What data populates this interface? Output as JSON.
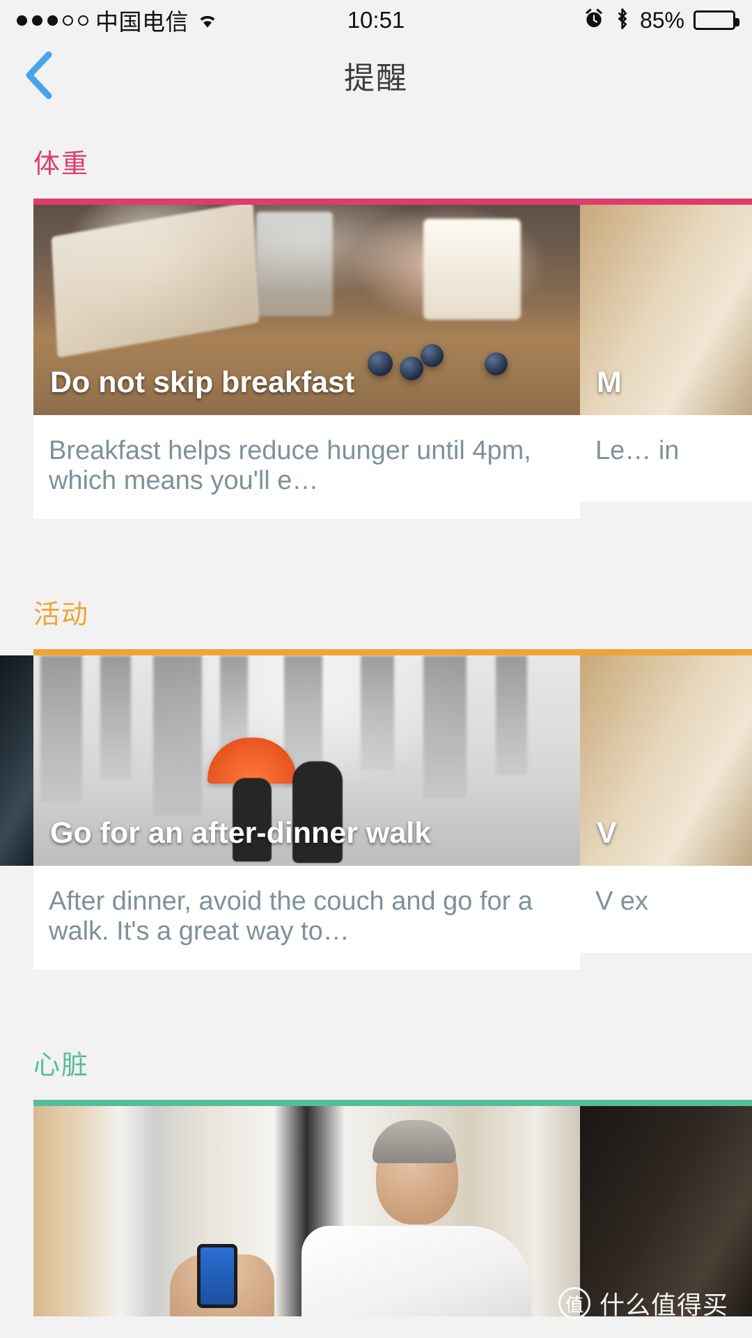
{
  "status_bar": {
    "signal_filled": 3,
    "signal_empty": 2,
    "carrier": "中国电信",
    "wifi_icon": "wifi-icon",
    "time": "10:51",
    "alarm_icon": "alarm-clock-icon",
    "bluetooth_icon": "bluetooth-icon",
    "battery_percent": "85%"
  },
  "navbar": {
    "back_icon": "chevron-left-icon",
    "title": "提醒"
  },
  "colors": {
    "weight": "#dd3d6b",
    "activity": "#eda536",
    "heart": "#56bd9c",
    "back_chevron": "#4aa3e8",
    "description_text": "#7d919c",
    "page_background": "#f2f2f2"
  },
  "sections": [
    {
      "id": "weight",
      "label": "体重",
      "accent": "#dd3d6b",
      "cards": [
        {
          "title": "Do not skip breakfast",
          "description": "Breakfast helps reduce hunger until 4pm, which means you'll e…",
          "image": "breakfast-book-blueberries"
        },
        {
          "title": "M",
          "description": "Le… in",
          "image": "peek-warm-room"
        }
      ]
    },
    {
      "id": "activity",
      "label": "活动",
      "accent": "#eda536",
      "cards": [
        {
          "title": "Go for an after-dinner walk",
          "description": "After dinner, avoid the couch and go for a walk. It's a great way to…",
          "image": "snow-walk-orange-umbrella"
        },
        {
          "title": "V",
          "description": "V ex",
          "image": "peek-warm-room"
        }
      ]
    },
    {
      "id": "heart",
      "label": "心脏",
      "accent": "#56bd9c",
      "cards": [
        {
          "title": "",
          "description": "",
          "image": "man-with-phone-office"
        },
        {
          "title": "",
          "description": "",
          "image": "peek-dark-room"
        }
      ]
    }
  ],
  "watermark": {
    "badge": "值",
    "text": "什么值得买"
  }
}
